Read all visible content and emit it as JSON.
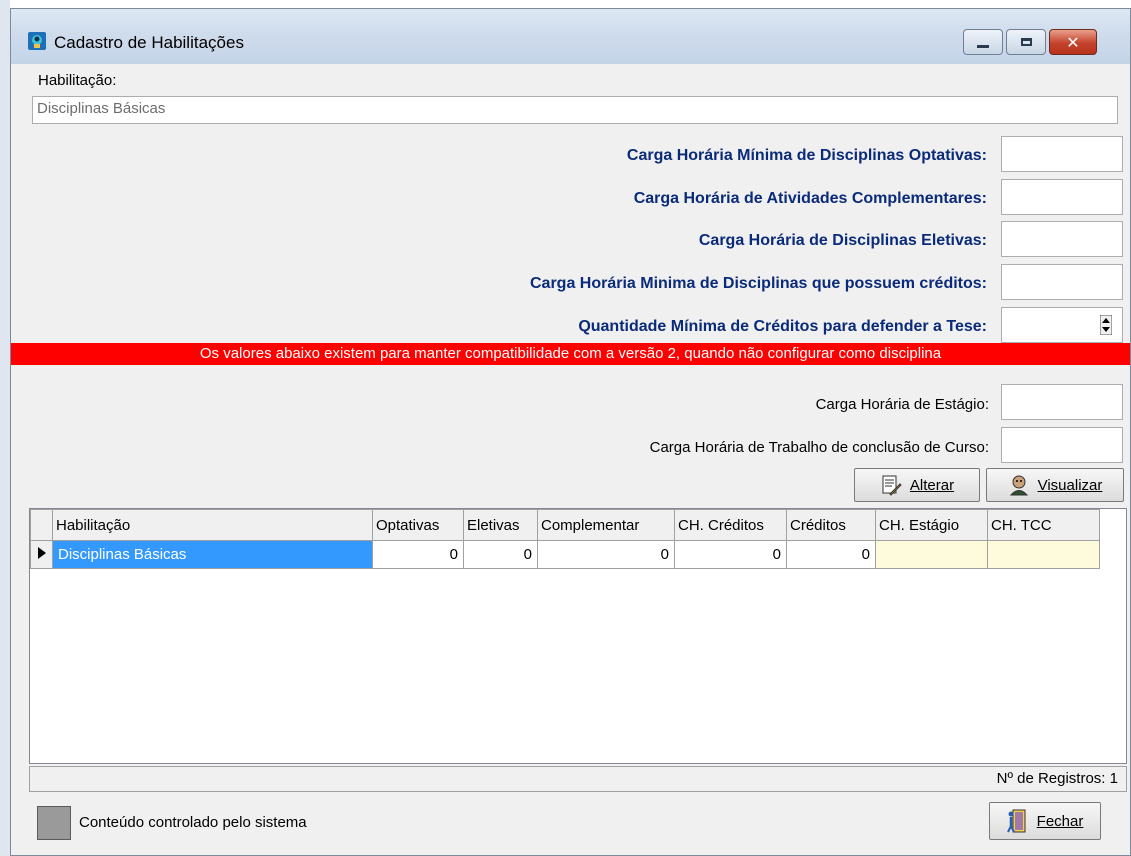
{
  "window": {
    "title": "Cadastro de Habilitações",
    "controls": {
      "minimize": "minimize-icon",
      "maximize": "maximize-icon",
      "close": "close-icon"
    }
  },
  "form": {
    "habilitacao_label": "Habilitação:",
    "habilitacao_value": "Disciplinas Básicas",
    "fields": [
      {
        "label": "Carga Horária Mínima de Disciplinas Optativas:",
        "value": ""
      },
      {
        "label": "Carga Horária de Atividades Complementares:",
        "value": ""
      },
      {
        "label": "Carga Horária de Disciplinas Eletivas:",
        "value": ""
      },
      {
        "label": "Carga Horária Minima de Disciplinas que possuem créditos:",
        "value": ""
      },
      {
        "label": "Quantidade Mínima de Créditos para defender a Tese:",
        "value": ""
      }
    ],
    "warning": "Os valores abaixo existem para manter compatibilidade com a versão 2, quando não configurar como disciplina",
    "legacy_fields": [
      {
        "label": "Carga Horária de Estágio:",
        "value": ""
      },
      {
        "label": "Carga Horária de Trabalho de conclusão de Curso:",
        "value": ""
      }
    ]
  },
  "buttons": {
    "alterar": "Alterar",
    "visualizar": "Visualizar",
    "fechar": "Fechar"
  },
  "grid": {
    "columns": [
      "Habilitação",
      "Optativas",
      "Eletivas",
      "Complementar",
      "CH. Créditos",
      "Créditos",
      "CH. Estágio",
      "CH. TCC"
    ],
    "rows": [
      [
        "Disciplinas Básicas",
        "0",
        "0",
        "0",
        "0",
        "0",
        "",
        ""
      ]
    ]
  },
  "status": {
    "records": "Nº de Registros: 1"
  },
  "legend": {
    "text": "Conteúdo controlado pelo sistema",
    "color": "#9a9a9a"
  }
}
